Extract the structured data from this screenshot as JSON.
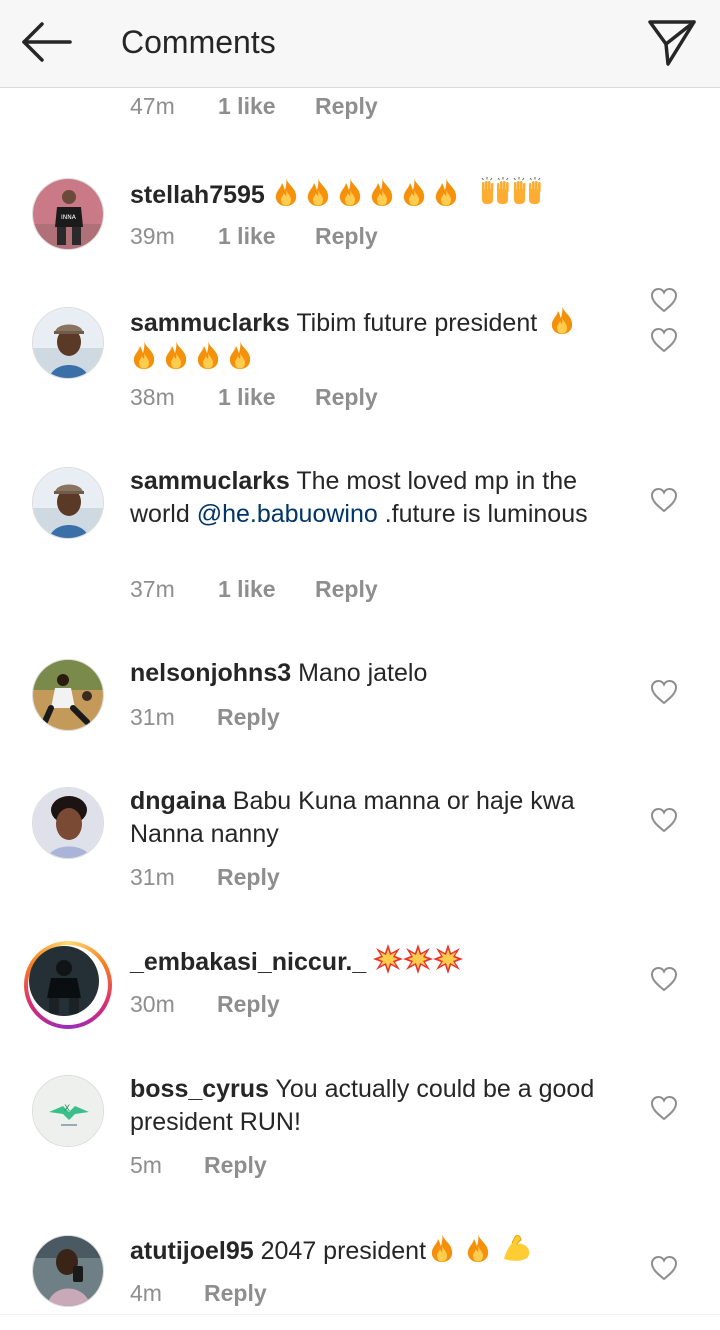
{
  "header": {
    "title": "Comments",
    "back_icon": "arrow-left-icon",
    "send_icon": "paper-plane-icon"
  },
  "top_meta": {
    "time": "47m",
    "likes": "1 like",
    "reply": "Reply"
  },
  "comments": [
    {
      "username": "stellah7595",
      "text": "",
      "emojis": [
        "fire",
        "fire",
        "fire",
        "fire",
        "fire",
        "fire",
        "raised-hands",
        "raised-hands"
      ],
      "time": "39m",
      "likes": "1 like",
      "reply": "Reply"
    },
    {
      "username": "sammuclarks",
      "text": "Tibim future president",
      "emojis": [
        "fire",
        "fire",
        "fire",
        "fire",
        "fire"
      ],
      "time": "38m",
      "likes": "1 like",
      "reply": "Reply"
    },
    {
      "username": "sammuclarks",
      "text_a": "The most loved mp  in the world",
      "mention": "@he.babuowino",
      "text_b": ".future is luminous",
      "time": "37m",
      "likes": "1 like",
      "reply": "Reply"
    },
    {
      "username": "nelsonjohns3",
      "text": "Mano jatelo",
      "time": "31m",
      "reply": "Reply"
    },
    {
      "username": "dngaina",
      "text": "Babu Kuna manna or haje kwa Nanna nanny",
      "time": "31m",
      "reply": "Reply"
    },
    {
      "username": "_embakasi_niccur._",
      "text": "",
      "emojis": [
        "collision",
        "collision",
        "collision"
      ],
      "time": "30m",
      "reply": "Reply"
    },
    {
      "username": "boss_cyrus",
      "text": "You actually could be a good president RUN!",
      "time": "5m",
      "reply": "Reply"
    },
    {
      "username": "atutijoel95",
      "text": "2047 president",
      "emojis": [
        "fire",
        "fire",
        "flexed-biceps"
      ],
      "time": "4m",
      "reply": "Reply"
    }
  ],
  "colors": {
    "header_bg": "#f7f7f7",
    "text": "#262626",
    "muted": "#8e8e8e",
    "mention": "#003569"
  }
}
